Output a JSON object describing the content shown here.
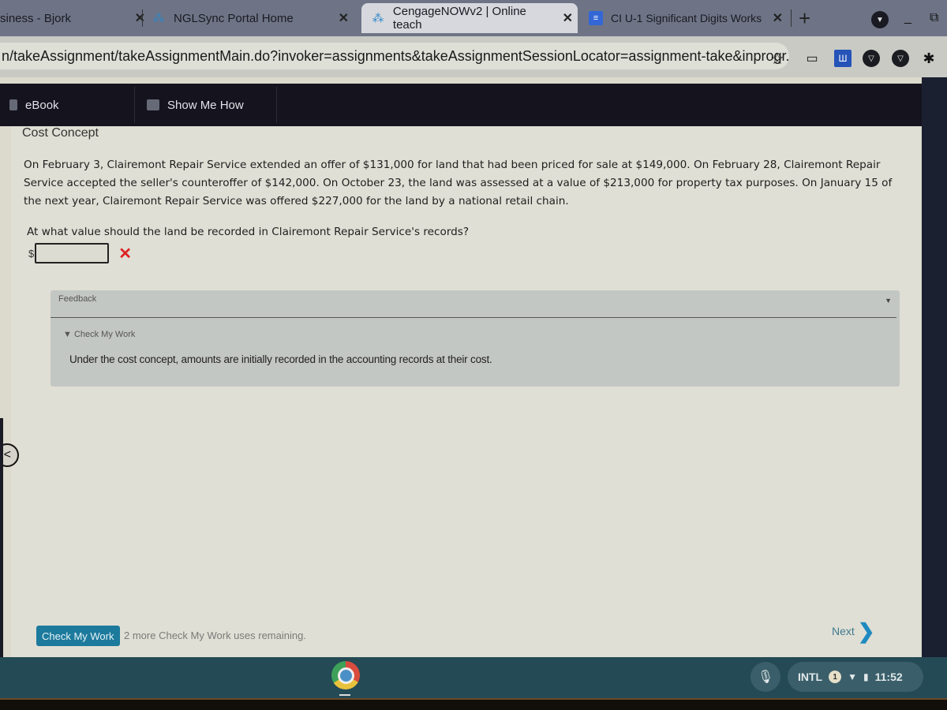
{
  "browser": {
    "tabs": [
      {
        "label": "siness - Bjork",
        "icon": "none",
        "active": false
      },
      {
        "label": "NGLSync Portal Home",
        "icon": "spark-icon",
        "active": false
      },
      {
        "label": "CengageNOWv2 | Online teach",
        "icon": "spark-icon",
        "active": true
      },
      {
        "label": "CI U-1 Significant Digits Works",
        "icon": "docs-icon",
        "active": false
      }
    ],
    "close_glyph": "✕",
    "new_tab_glyph": "+",
    "minimize_glyph": "_",
    "restore_glyph": "⧉",
    "url": "n/takeAssignment/takeAssignmentMain.do?invoker=assignments&takeAssignmentSessionLocator=assignment-take&inprogr...",
    "star_glyph": "☆",
    "extensions": [
      "cast-icon",
      "notes-icon",
      "shield-icon",
      "shield-icon",
      "puzzle-icon"
    ]
  },
  "nav": {
    "ebook_label": "eBook",
    "show_me_how_label": "Show Me How"
  },
  "problem": {
    "title": "Cost Concept",
    "text": "On February 3, Clairemont Repair Service extended an offer of $131,000 for land that had been priced for sale at $149,000. On February 28, Clairemont Repair Service accepted the seller's counteroffer of $142,000. On October 23, the land was assessed at a value of $213,000 for property tax purposes. On January 15 of the next year, Clairemont Repair Service was offered $227,000 for the land by a national retail chain.",
    "question": "At what value should the land be recorded in Clairemont Repair Service's records?",
    "currency": "$",
    "answer_value": "",
    "result_mark": "✕",
    "result_color": "#dd2222"
  },
  "feedback": {
    "title": "Feedback",
    "toggle_glyph": "▼",
    "check_header": "▼ Check My Work",
    "check_text": "Under the cost concept, amounts are initially recorded in the accounting records at their cost."
  },
  "footer": {
    "check_button": "Check My Work",
    "remaining": "2 more Check My Work uses remaining.",
    "next_label": "Next",
    "next_glyph": "❯",
    "back_glyph": "<",
    "accent": "#1c7a9c"
  },
  "shelf": {
    "mic_glyph": "🎙",
    "keyboard": "INTL",
    "notification_count": "1",
    "wifi_glyph": "▼",
    "battery_glyph": "▮",
    "time": "11:52"
  }
}
